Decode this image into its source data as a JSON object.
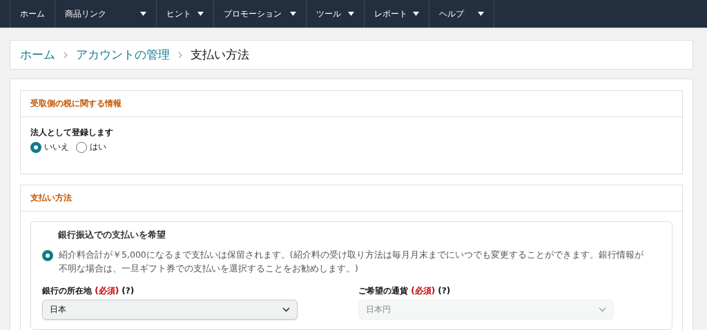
{
  "nav": [
    {
      "label": "ホーム",
      "dropdown": false
    },
    {
      "label": "商品リンク",
      "dropdown": true
    },
    {
      "label": "ヒント",
      "dropdown": true
    },
    {
      "label": "プロモーション",
      "dropdown": true
    },
    {
      "label": "ツール",
      "dropdown": true
    },
    {
      "label": "レポート",
      "dropdown": true
    },
    {
      "label": "ヘルプ",
      "dropdown": true
    }
  ],
  "breadcrumb": [
    {
      "label": "ホーム",
      "link": true
    },
    {
      "label": "アカウントの管理",
      "link": true
    },
    {
      "label": "支払い方法",
      "link": false
    }
  ],
  "tax_section": {
    "title": "受取側の税に関する情報",
    "question": "法人として登録します",
    "options": [
      {
        "label": "いいえ",
        "selected": true
      },
      {
        "label": "はい",
        "selected": false
      }
    ]
  },
  "payment_section": {
    "title": "支払い方法",
    "option": {
      "title": "銀行振込での支払いを希望",
      "selected": true,
      "description": "紹介料合計が￥5,000になるまで支払いは保留されます。(紹介料の受け取り方法は毎月月末までにいつでも変更することができます。銀行情報が不明な場合は、一旦ギフト券での支払いを選択することをお勧めします。)",
      "fields": [
        {
          "label": "銀行の所在地",
          "required": "(必須)",
          "help": "(?)",
          "value": "日本",
          "disabled": false
        },
        {
          "label": "ご希望の通貨",
          "required": "(必須)",
          "help": "(?)",
          "value": "日本円",
          "disabled": true
        }
      ]
    }
  }
}
